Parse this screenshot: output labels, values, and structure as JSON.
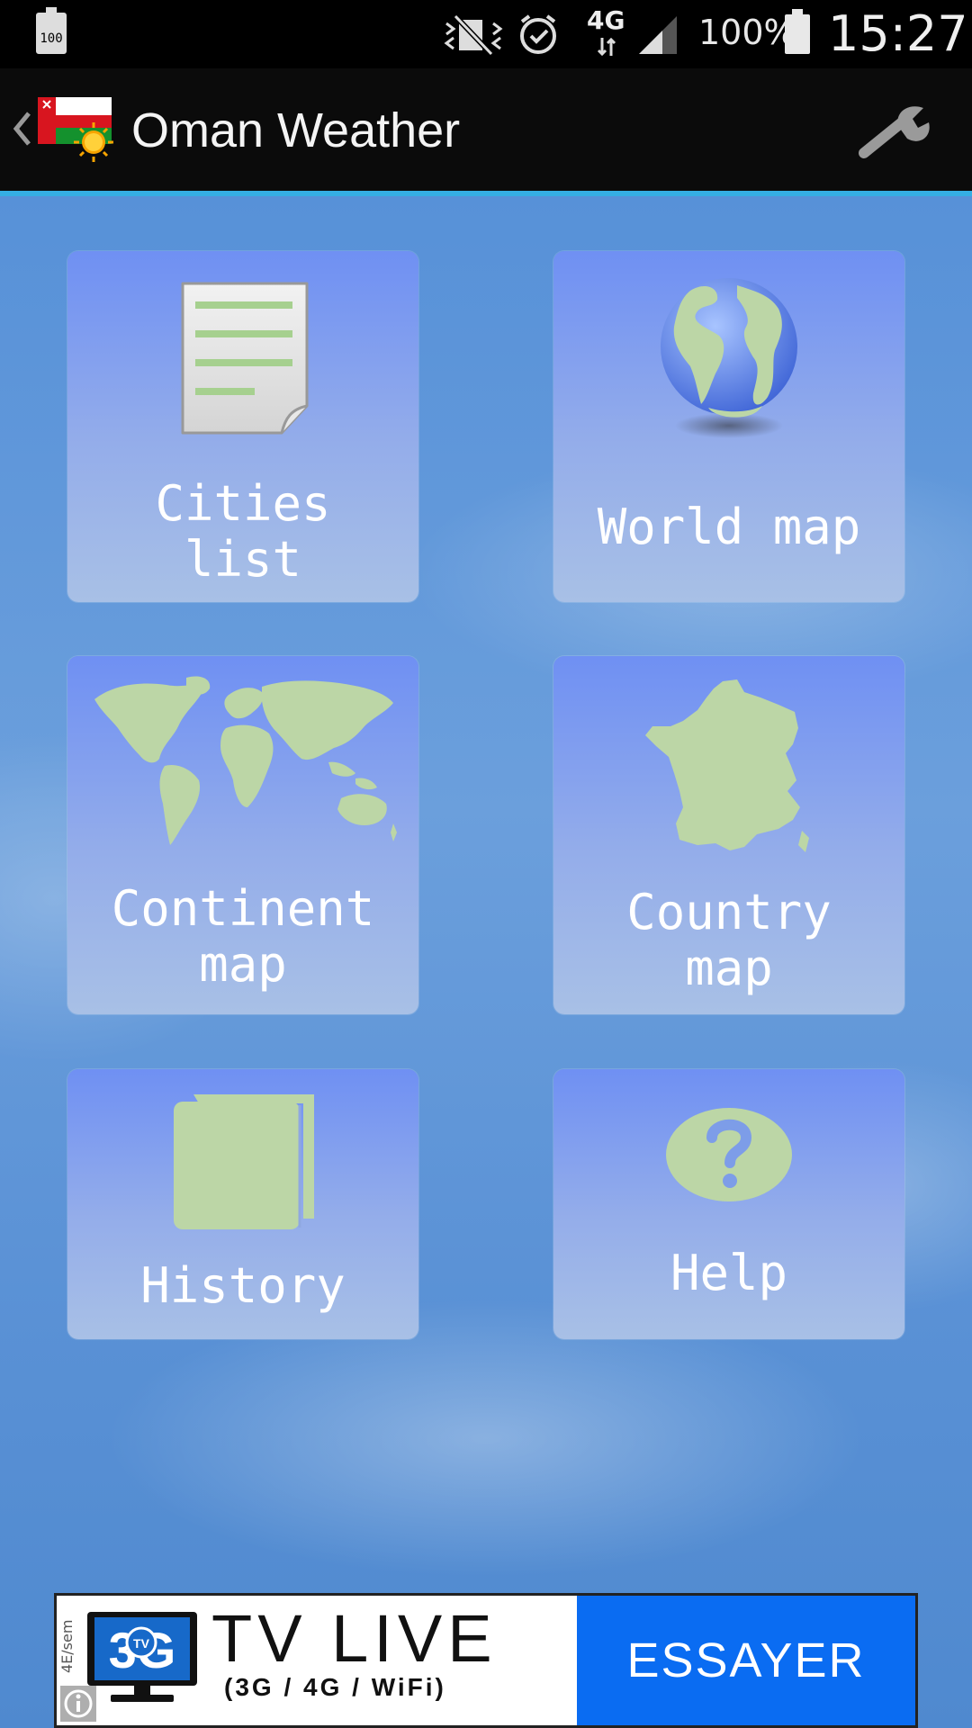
{
  "status_bar": {
    "battery_small_label": "100",
    "network": "4G",
    "battery_percent": "100%",
    "time": "15:27"
  },
  "action_bar": {
    "title": "Oman Weather"
  },
  "tiles": [
    {
      "label": "Cities\nlist",
      "icon": "document-icon"
    },
    {
      "label": "World map",
      "icon": "globe-icon"
    },
    {
      "label": "Continent\nmap",
      "icon": "world-map-icon"
    },
    {
      "label": "Country\nmap",
      "icon": "country-map-icon"
    },
    {
      "label": "History",
      "icon": "book-icon"
    },
    {
      "label": "Help",
      "icon": "question-icon"
    }
  ],
  "ad": {
    "logo_text": "3G",
    "logo_badge": "TV",
    "headline": "TV LIVE",
    "subline": "(3G / 4G / WiFi)",
    "side_text": "4E/sem",
    "cta": "ESSAYER"
  },
  "colors": {
    "accent": "#35aee3",
    "tile_top": "#6f90f3",
    "tile_bottom": "#a8c0e6",
    "icon_green": "#bcd6a6",
    "ad_blue": "#0a6cf2"
  }
}
